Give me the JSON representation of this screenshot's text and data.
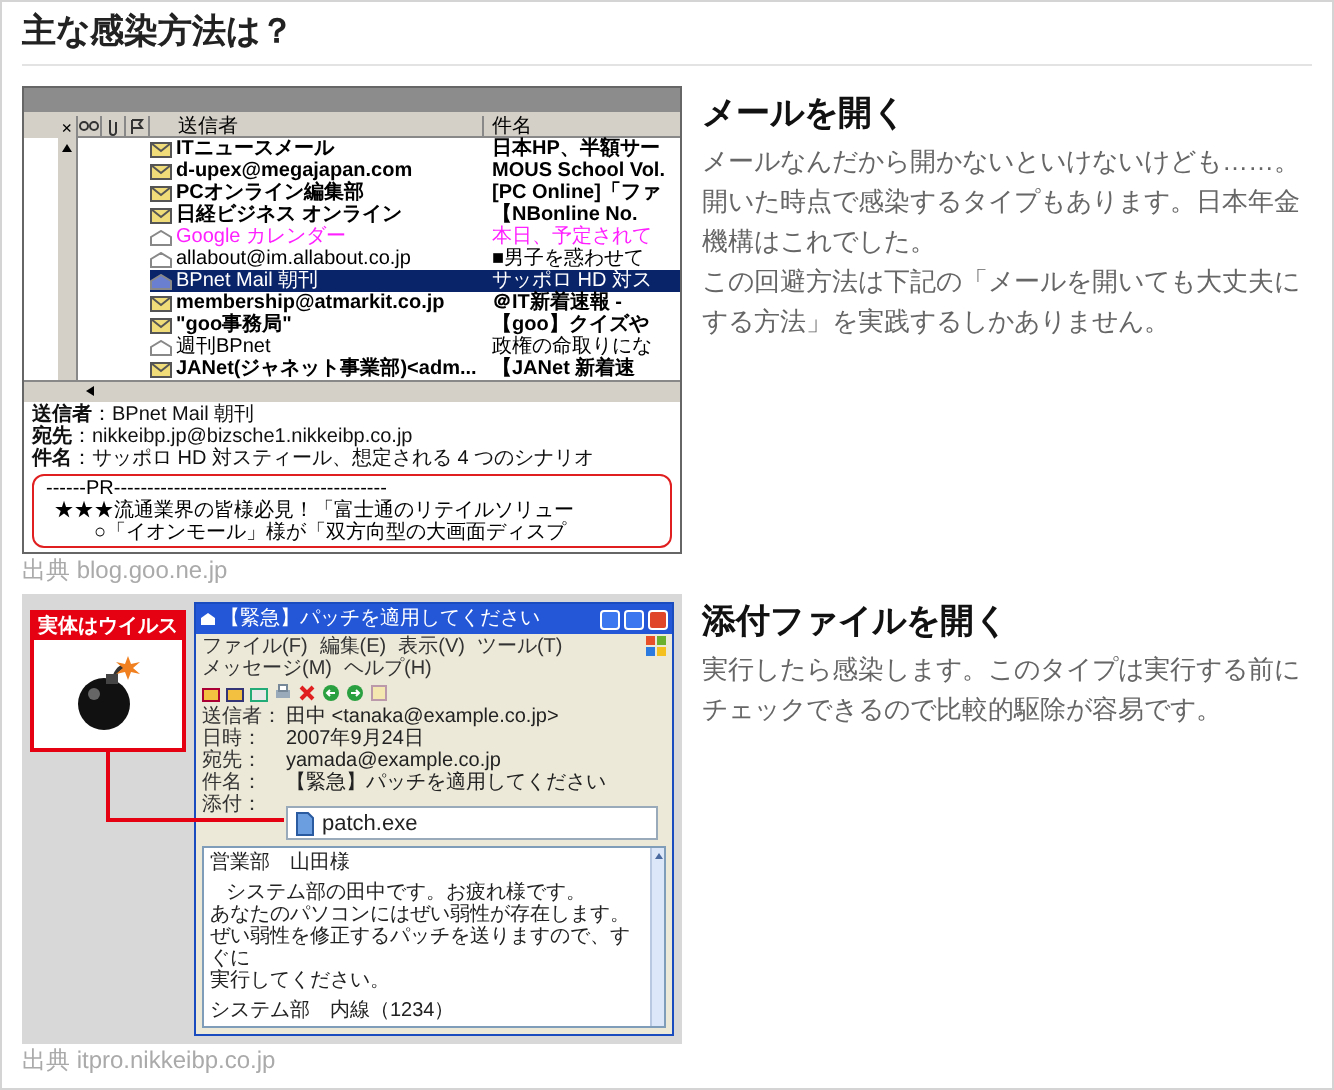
{
  "title": "主な感染方法は？",
  "sections": [
    {
      "kind": "mail-list",
      "heading": "メールを開く",
      "paragraphs": [
        "メールなんだから開かないといけないけども……。開いた時点で感染するタイプもあります。日本年金機構はこれでした。",
        "この回避方法は下記の「メールを開いても大丈夫にする方法」を実践するしかありません。"
      ],
      "source": "出典 blog.goo.ne.jp",
      "figure": {
        "folder_close": "×",
        "columns": [
          "送信者",
          "件名"
        ],
        "rows": [
          {
            "sender": "ITニュースメール",
            "subject": "日本HP、半額サー",
            "read": false,
            "selected": false,
            "color": "#000000"
          },
          {
            "sender": "d-upex@megajapan.com",
            "subject": "MOUS School Vol.",
            "read": false,
            "selected": false,
            "color": "#000000"
          },
          {
            "sender": "PCオンライン編集部",
            "subject": "[PC Online]「ファ",
            "read": false,
            "selected": false,
            "color": "#000000"
          },
          {
            "sender": "日経ビジネス オンライン",
            "subject": "【NBonline No.",
            "read": false,
            "selected": false,
            "color": "#000000"
          },
          {
            "sender": "Google カレンダー",
            "subject": "本日、予定されて",
            "read": true,
            "selected": false,
            "color": "#ff20ff"
          },
          {
            "sender": "allabout@im.allabout.co.jp",
            "subject": "■男子を惑わせて",
            "read": true,
            "selected": false,
            "color": "#000000"
          },
          {
            "sender": "BPnet Mail 朝刊",
            "subject": "サッポロ HD 対ス",
            "read": true,
            "selected": true
          },
          {
            "sender": "membership@atmarkit.co.jp",
            "subject": "＠IT新着速報 -",
            "read": false,
            "selected": false,
            "color": "#000000"
          },
          {
            "sender": "\"goo事務局\"",
            "subject": "【goo】クイズや",
            "read": false,
            "selected": false,
            "color": "#000000"
          },
          {
            "sender": "週刊BPnet",
            "subject": "政権の命取りにな",
            "read": true,
            "selected": false,
            "color": "#000000"
          },
          {
            "sender": "JANet(ジャネット事業部)<adm...",
            "subject": "【JANet 新着速",
            "read": false,
            "selected": false,
            "color": "#000000"
          }
        ],
        "preview": [
          "**送信者**：BPnet Mail 朝刊",
          "**宛先**：nikkeibp.jp@bizsche1.nikkeibp.co.jp",
          "**件名**：サッポロ HD 対スティール、想定される 4 つのシナリオ"
        ],
        "pr_lines": [
          "------PR-----------------------------------------",
          "★★★流通業界の皆様必見！「富士通のリテイルソリュー",
          "○「イオンモール」様が「双方向型の大画面ディスプ"
        ]
      }
    },
    {
      "kind": "mail-window",
      "heading": "添付ファイルを開く",
      "paragraphs": [
        "実行したら感染します。このタイプは実行する前にチェックできるので比較的駆除が容易です。"
      ],
      "source": "出典 itpro.nikkeibp.co.jp",
      "figure": {
        "label": "実体はウイルス",
        "title": "【緊急】パッチを適用してください",
        "menu": [
          "ファイル(F)",
          "編集(E)",
          "表示(V)",
          "ツール(T)",
          "メッセージ(M)",
          "ヘルプ(H)"
        ],
        "fields": [
          {
            "label": "送信者：",
            "value": "田中 <tanaka@example.co.jp>"
          },
          {
            "label": "日時：",
            "value": "2007年9月24日"
          },
          {
            "label": "宛先：",
            "value": "yamada@example.co.jp"
          },
          {
            "label": "件名：",
            "value": "【緊急】パッチを適用してください"
          }
        ],
        "attachment_label": "添付：",
        "attachment": "patch.exe",
        "greeting": "営業部　山田様",
        "body_lines": [
          "システム部の田中です。お疲れ様です。",
          "あなたのパソコンにはぜい弱性が存在します。",
          "ぜい弱性を修正するパッチを送りますので、すぐに",
          "実行してください。"
        ],
        "signature": "システム部　内線（1234）"
      }
    }
  ]
}
